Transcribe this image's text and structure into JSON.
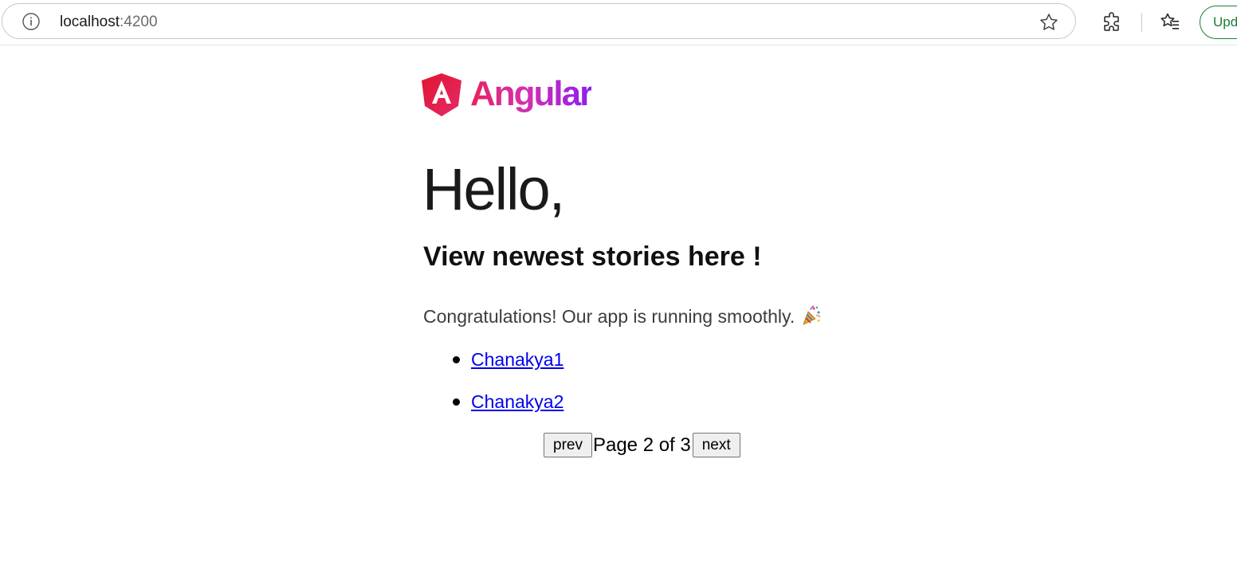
{
  "browser": {
    "url_host": "localhost",
    "url_port": ":4200",
    "update_label": "Update"
  },
  "page": {
    "logo_text": "Angular",
    "hello": "Hello,",
    "subtitle": "View newest stories here !",
    "congrats": "Congratulations! Our app is running smoothly.",
    "stories": [
      {
        "label": "Chanakya1"
      },
      {
        "label": "Chanakya2"
      }
    ],
    "pager": {
      "prev_label": "prev",
      "page_text": "Page 2 of 3",
      "next_label": "next",
      "current_page": 2,
      "total_pages": 3
    }
  },
  "colors": {
    "link": "#0000ee",
    "angular_red": "#e6245c",
    "angular_purple": "#8a1ff0",
    "update_green": "#1e7d32"
  },
  "icons": {
    "info": "info-icon",
    "favorite": "star-icon",
    "extensions": "puzzle-icon",
    "favorites_list": "favorites-icon",
    "celebration": "party-popper-icon"
  }
}
